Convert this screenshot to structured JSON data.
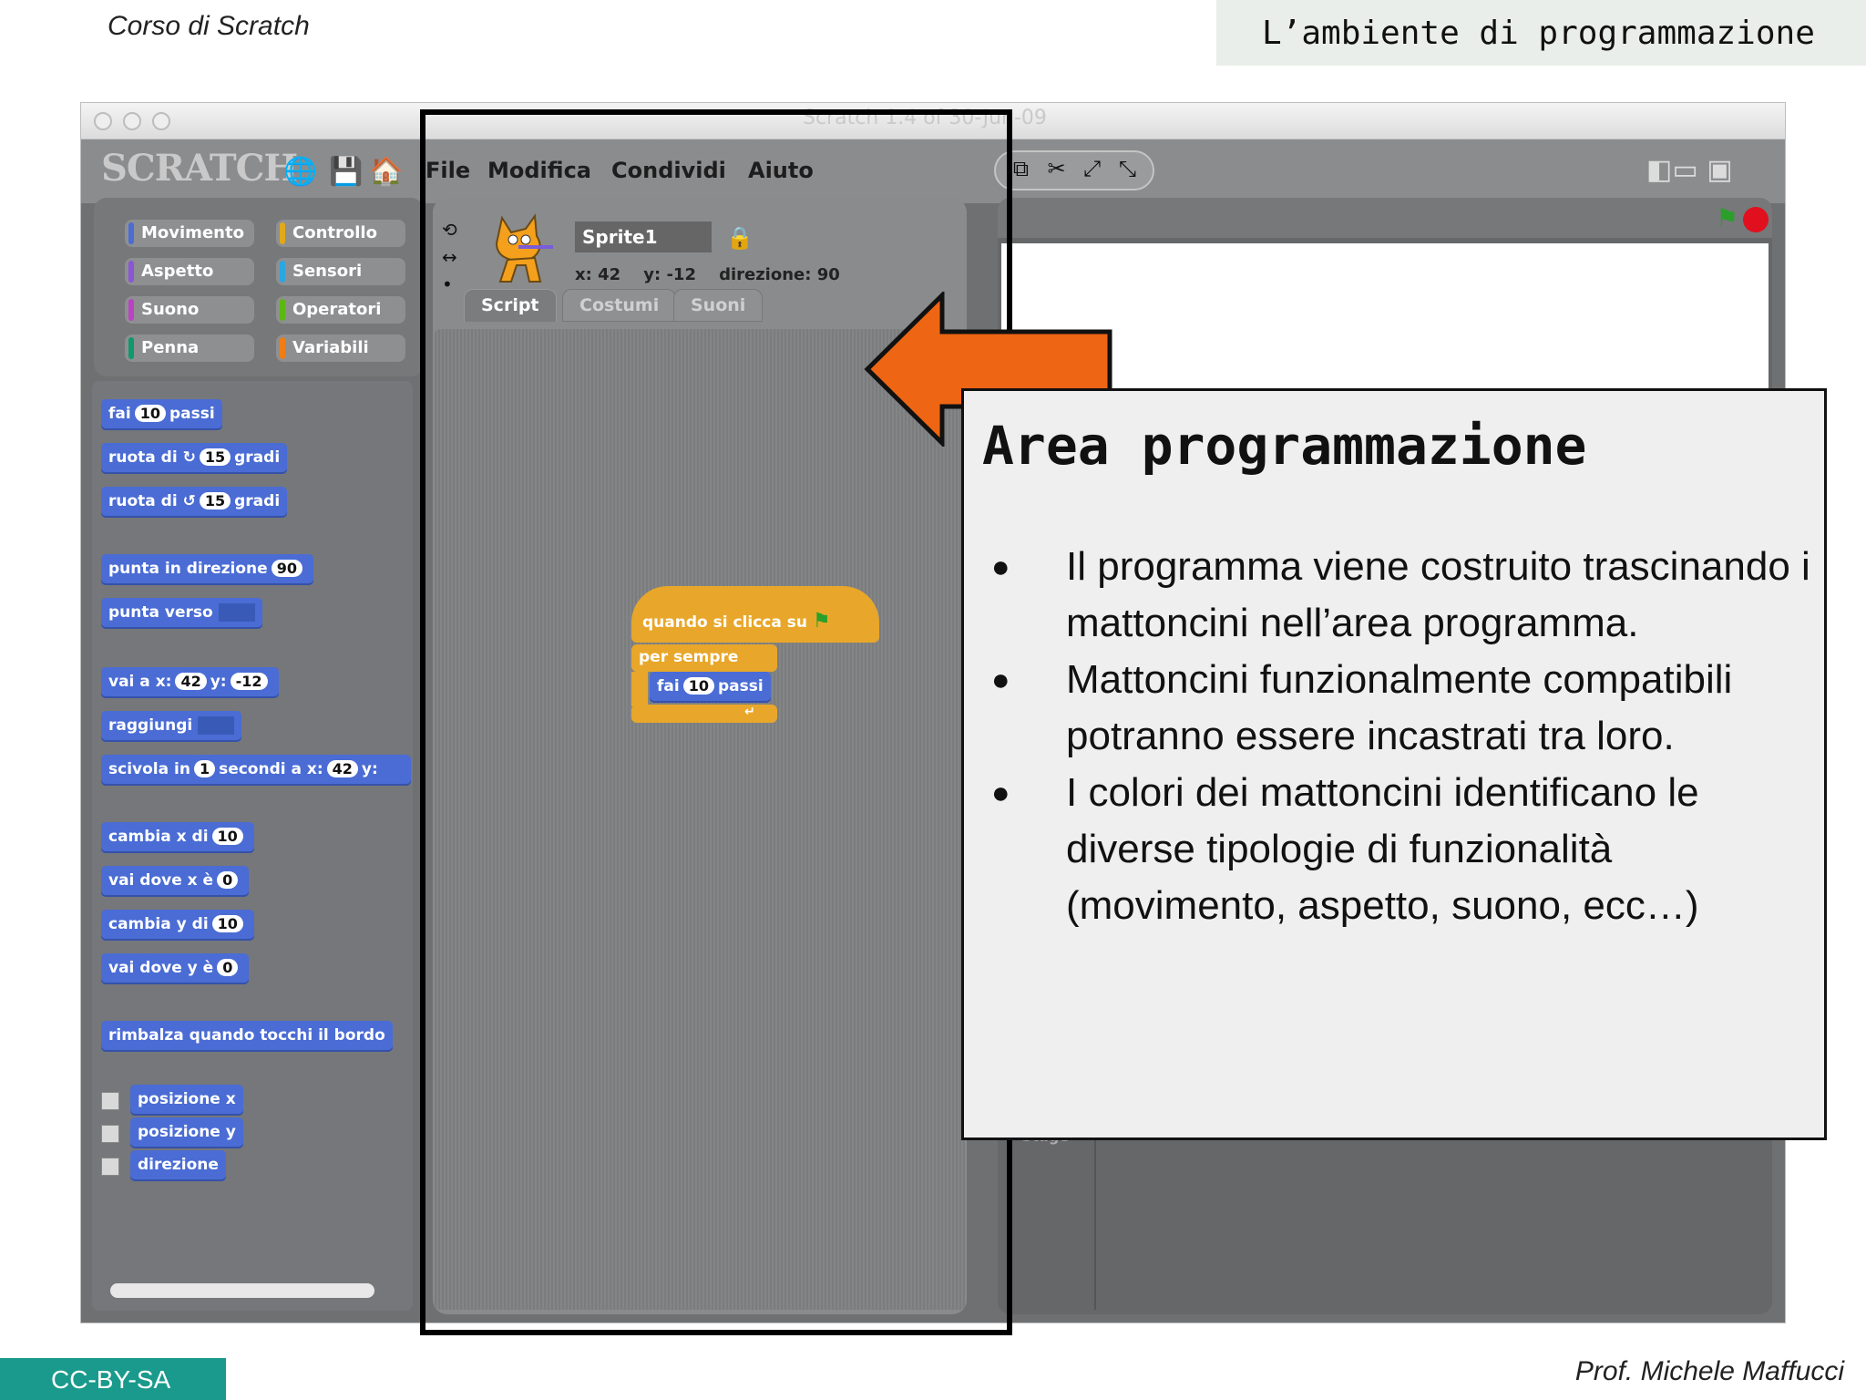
{
  "slide": {
    "course": "Corso di Scratch",
    "section": "L’ambiente di programmazione",
    "license": "CC-BY-SA",
    "author": "Prof. Michele Maffucci"
  },
  "window": {
    "title": "Scratch 1.4 of 30-Jun-09",
    "logo": "SCRATCH",
    "menu": [
      "File",
      "Modifica",
      "Condividi",
      "Aiuto"
    ]
  },
  "categories": [
    {
      "label": "Movimento",
      "color": "#4a6cd4"
    },
    {
      "label": "Controllo",
      "color": "#e1a91a"
    },
    {
      "label": "Aspetto",
      "color": "#8a55d7"
    },
    {
      "label": "Sensori",
      "color": "#2ca5e2"
    },
    {
      "label": "Suono",
      "color": "#bb42c3"
    },
    {
      "label": "Operatori",
      "color": "#5cb712"
    },
    {
      "label": "Penna",
      "color": "#0e9a6c"
    },
    {
      "label": "Variabili",
      "color": "#ee7d16"
    }
  ],
  "blocks": {
    "fai": "fai",
    "passi": "passi",
    "n10": "10",
    "ruota_di": "ruota di",
    "gradi": "gradi",
    "n15": "15",
    "punta_dir": "punta in direzione",
    "n90": "90",
    "punta_verso": "punta verso",
    "vai_a_x": "vai a x:",
    "y_lbl": "y:",
    "n42": "42",
    "nm12": "-12",
    "raggiungi": "raggiungi",
    "scivola": "scivola in",
    "n1": "1",
    "secondi": "secondi a x:",
    "cambia_x": "cambia x di",
    "vai_dove_x": "vai dove x è",
    "n0": "0",
    "cambia_y": "cambia y di",
    "vai_dove_y": "vai dove y è",
    "rimbalza": "rimbalza quando tocchi il bordo",
    "pos_x": "posizione x",
    "pos_y": "posizione y",
    "direzione": "direzione"
  },
  "sprite": {
    "name": "Sprite1",
    "x_label": "x:",
    "x": "42",
    "y_label": "y:",
    "y": "-12",
    "dir_label": "direzione:",
    "dir": "90",
    "tabs": [
      "Script",
      "Costumi",
      "Suoni"
    ]
  },
  "script": {
    "hat": "quando si clicca su",
    "forever": "per sempre",
    "fai": "fai",
    "n10": "10",
    "passi": "passi"
  },
  "stage": {
    "label": "Stage"
  },
  "callout": {
    "title": "Area programmazione",
    "bullets": [
      "Il programma viene costruito trascinando i mattoncini nell’area programma.",
      "Mattoncini funzionalmente compatibili potranno essere incastrati tra loro.",
      "I colori dei mattoncini identificano le diverse tipologie di funzionalità (movimento, aspetto, suono, ecc…)"
    ]
  }
}
